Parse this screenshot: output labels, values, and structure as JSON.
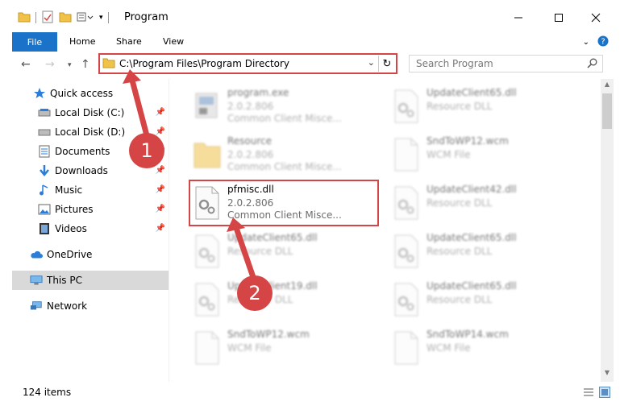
{
  "window": {
    "title": "Program"
  },
  "ribbon": {
    "tabs": [
      "File",
      "Home",
      "Share",
      "View"
    ]
  },
  "address": {
    "path": "C:\\Program Files\\Program Directory"
  },
  "search": {
    "placeholder": "Search Program"
  },
  "sidebar": {
    "items": [
      {
        "label": "Quick access",
        "icon": "star-icon"
      },
      {
        "label": "Local Disk (C:)",
        "icon": "drive-icon",
        "pinned": true
      },
      {
        "label": "Local Disk (D:)",
        "icon": "drive-icon",
        "pinned": true
      },
      {
        "label": "Documents",
        "icon": "document-icon",
        "pinned": true
      },
      {
        "label": "Downloads",
        "icon": "download-icon",
        "pinned": true
      },
      {
        "label": "Music",
        "icon": "music-icon",
        "pinned": true
      },
      {
        "label": "Pictures",
        "icon": "pictures-icon",
        "pinned": true
      },
      {
        "label": "Videos",
        "icon": "video-icon",
        "pinned": true
      },
      {
        "label": "OneDrive",
        "icon": "cloud-icon"
      },
      {
        "label": "This PC",
        "icon": "computer-icon",
        "selected": true
      },
      {
        "label": "Network",
        "icon": "network-icon"
      }
    ]
  },
  "files": {
    "left": [
      {
        "name": "program.exe",
        "line2": "2.0.2.806",
        "line3": "Common Client Misce...",
        "icon": "exe-icon"
      },
      {
        "name": "Resource",
        "line2": "2.0.2.806",
        "line3": "Common Client Misce...",
        "icon": "folder-icon"
      },
      {
        "name": "pfmisc.dll",
        "line2": "2.0.2.806",
        "line3": "Common Client Misce...",
        "icon": "dll-icon"
      },
      {
        "name": "UpdateClient65.dll",
        "line2": "Resource DLL",
        "line3": "",
        "icon": "dll-icon"
      },
      {
        "name": "UpdateClient19.dll",
        "line2": "Resource DLL",
        "line3": "",
        "icon": "dll-icon"
      },
      {
        "name": "SndToWP12.wcm",
        "line2": "WCM File",
        "line3": "",
        "icon": "file-icon"
      }
    ],
    "right": [
      {
        "name": "UpdateClient65.dll",
        "line2": "Resource DLL",
        "icon": "dll-icon"
      },
      {
        "name": "SndToWP12.wcm",
        "line2": "WCM File",
        "icon": "file-icon"
      },
      {
        "name": "UpdateClient42.dll",
        "line2": "Resource DLL",
        "icon": "dll-icon"
      },
      {
        "name": "UpdateClient65.dll",
        "line2": "Resource DLL",
        "icon": "dll-icon"
      },
      {
        "name": "UpdateClient65.dll",
        "line2": "Resource DLL",
        "icon": "dll-icon"
      },
      {
        "name": "SndToWP14.wcm",
        "line2": "WCM File",
        "icon": "file-icon"
      }
    ]
  },
  "status": {
    "count": "124 items"
  },
  "annotations": {
    "badge1": "1",
    "badge2": "2"
  },
  "colors": {
    "accent": "#1a73c9",
    "annotation": "#d64545",
    "selected": "#d9d9d9"
  }
}
